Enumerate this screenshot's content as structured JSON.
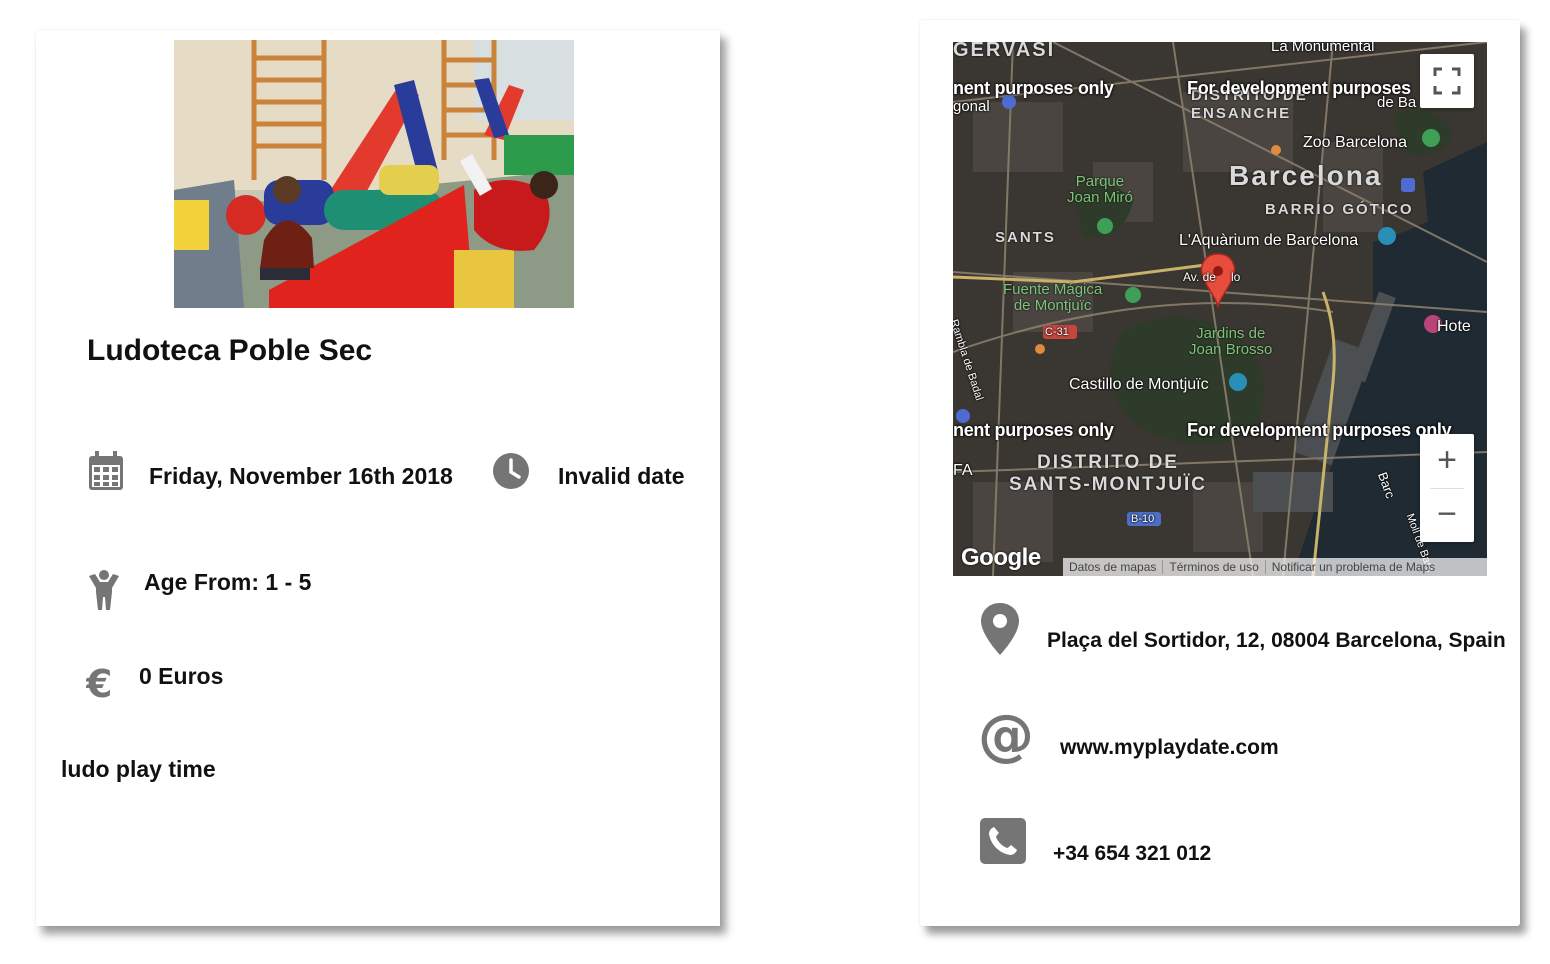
{
  "event": {
    "title": "Ludoteca Poble Sec",
    "date": "Friday, November 16th 2018",
    "time": "Invalid date",
    "age": "Age From: 1 - 5",
    "price": "0 Euros",
    "description": "ludo play time"
  },
  "venue": {
    "address": "Plaça del Sortidor, 12, 08004 Barcelona, Spain",
    "website": "www.myplaydate.com",
    "phone": "+34 654 321 012"
  },
  "map": {
    "dev_watermark": "For development purposes only",
    "dev_watermark_partial": "nent purposes only",
    "dev_watermark_cut": "For development purposes",
    "labels": {
      "gervasi": "GERVASI",
      "la_monumental": "La Monumental",
      "gonal": "gonal",
      "ensanche_a": "DISTRITO DE",
      "ensanche_b": "ENSANCHE",
      "de_ba": "de Ba",
      "zoo": "Zoo Barcelona",
      "barcelona": "Barcelona",
      "gotico": "BARRIO GÓTICO",
      "parque_a": "Parque",
      "parque_b": "Joan Miró",
      "sants": "SANTS",
      "aquarium": "L'Aquàrium de Barcelona",
      "av": "Av. de",
      "av_end": "lo",
      "fuente_a": "Fuente Mágica",
      "fuente_b": "de Montjuïc",
      "rambla": "Rambla de Badal",
      "c31": "C-31",
      "jardins_a": "Jardins de",
      "jardins_b": "Joan Brosso",
      "castillo": "Castillo de Montjuïc",
      "hotel": "Hote",
      "fa": "FA",
      "montjuic_a": "DISTRITO DE",
      "montjuic_b": "SANTS-MONTJUÏC",
      "b10": "B-10",
      "barc": "Barc",
      "moll": "Moll de Barc"
    },
    "google": "Google",
    "attribution": [
      "Datos de mapas",
      "Términos de uso",
      "Notificar un problema de Maps"
    ],
    "zoom_in": "+",
    "zoom_out": "−"
  },
  "icons": {
    "calendar": "calendar-icon",
    "clock": "clock-icon",
    "child": "child-icon",
    "euro": "euro-icon",
    "pin": "location-pin-icon",
    "at": "at-icon",
    "phone": "phone-icon"
  },
  "colors": {
    "icon_gray": "#757575",
    "marker_red": "#e74c3c",
    "map_dark": "#3a3631"
  }
}
